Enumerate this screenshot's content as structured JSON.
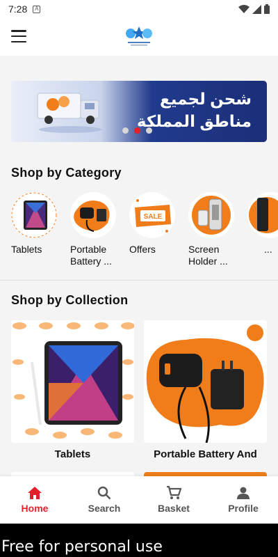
{
  "status_bar": {
    "time": "7:28",
    "notification_icon": "A"
  },
  "app_bar": {
    "menu_icon": "hamburger-menu-icon",
    "logo": "store-logo"
  },
  "banner": {
    "text": "شحن لجميع مناطق المملكة",
    "dots": 3,
    "active_dot": 1
  },
  "categories": {
    "title": "Shop by Category",
    "items": [
      {
        "label": "Tablets"
      },
      {
        "label": "Portable Battery ..."
      },
      {
        "label": "Offers"
      },
      {
        "label": "Screen Holder ..."
      },
      {
        "label": "..."
      }
    ]
  },
  "collections": {
    "title": "Shop by Collection",
    "items": [
      {
        "label": "Tablets"
      },
      {
        "label": "Portable Battery And"
      }
    ]
  },
  "bottom_nav": {
    "items": [
      {
        "label": "Home",
        "icon": "home-icon",
        "active": true
      },
      {
        "label": "Search",
        "icon": "search-icon",
        "active": false
      },
      {
        "label": "Basket",
        "icon": "cart-icon",
        "active": false
      },
      {
        "label": "Profile",
        "icon": "profile-icon",
        "active": false
      }
    ]
  },
  "colors": {
    "accent": "#e4212a",
    "orange": "#f07d1a",
    "banner_blue": "#1c2f78"
  },
  "watermark": "Free for personal use"
}
